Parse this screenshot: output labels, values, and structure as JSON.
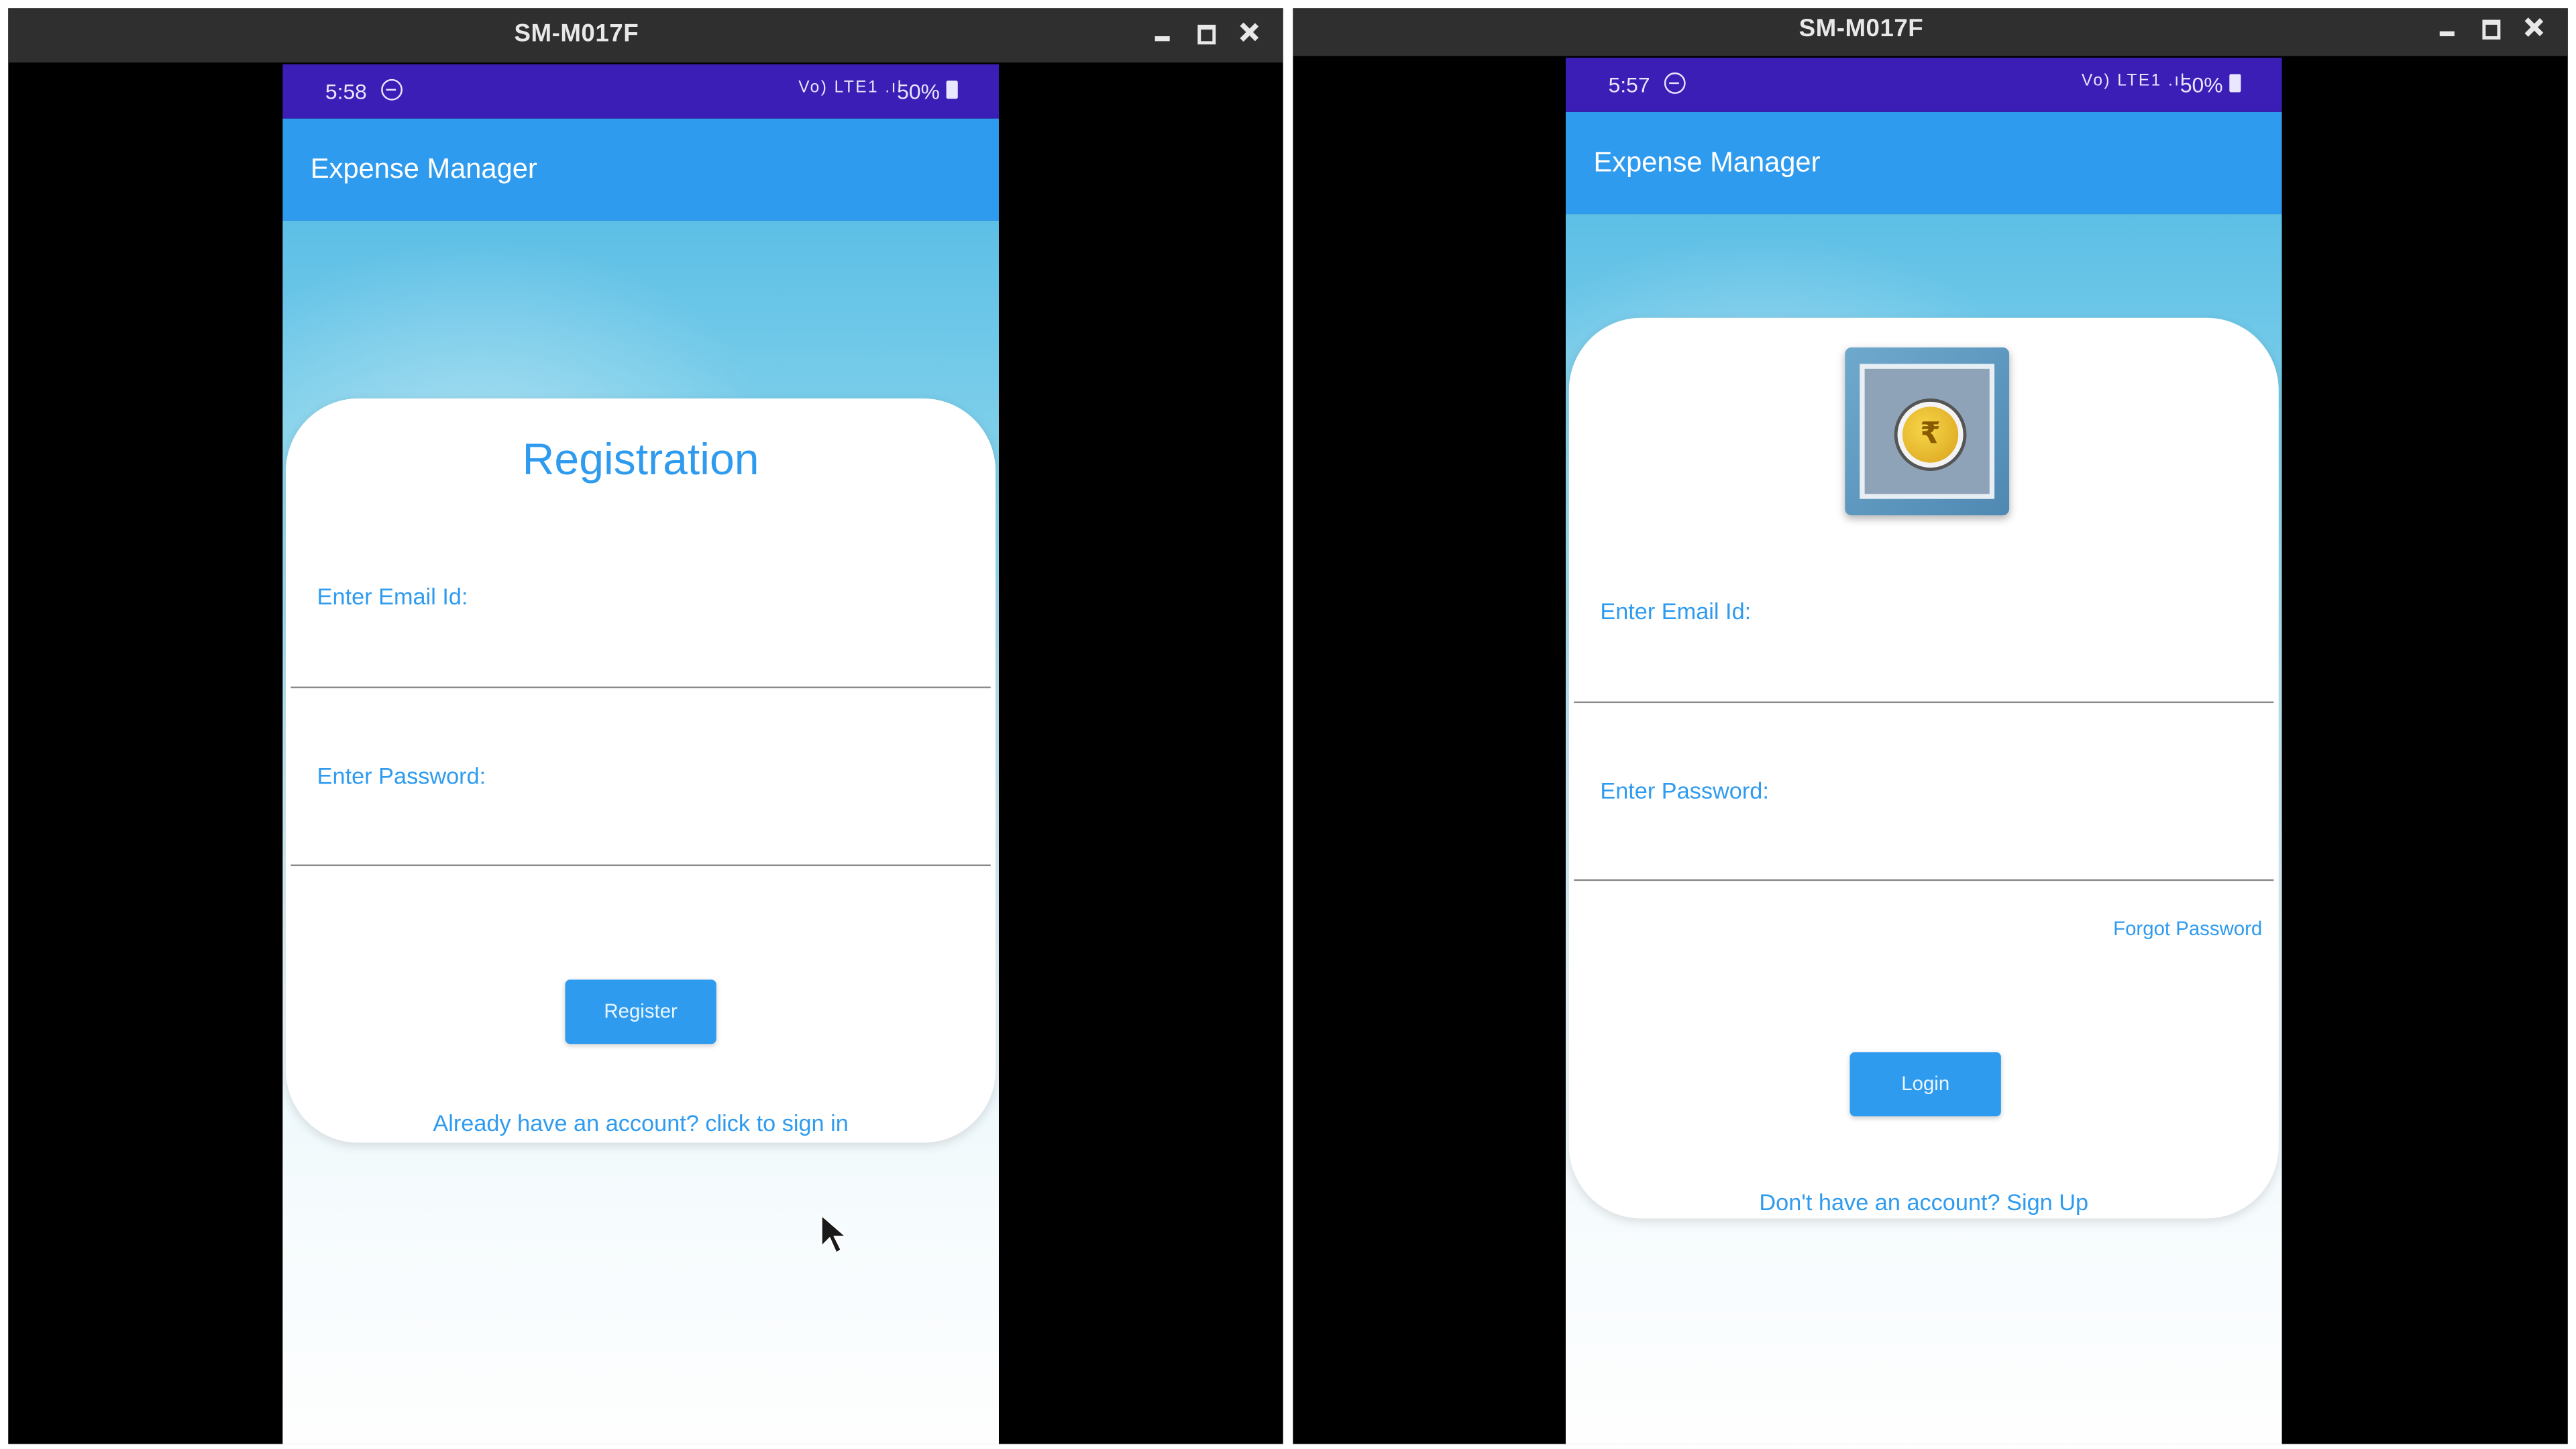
{
  "windows": [
    {
      "title": "SM-M017F",
      "status_bar": {
        "time": "5:58",
        "signal": "Vo) LTE1 .ıl",
        "battery": "50%"
      },
      "app_title": "Expense Manager",
      "screen": {
        "heading": "Registration",
        "email_label": "Enter Email Id:",
        "password_label": "Enter Password:",
        "button_label": "Register",
        "link_text": "Already have an account? click to sign in"
      }
    },
    {
      "title": "SM-M017F",
      "status_bar": {
        "time": "5:57",
        "signal": "Vo) LTE1 .ıl",
        "battery": "50%"
      },
      "app_title": "Expense Manager",
      "screen": {
        "logo_symbol": "₹",
        "email_label": "Enter Email Id:",
        "password_label": "Enter Password:",
        "forgot_label": "Forgot Password",
        "button_label": "Login",
        "link_text": "Don't have an account? Sign Up"
      }
    }
  ],
  "colors": {
    "status_bar": "#3b1eb5",
    "app_bar": "#2f9bef",
    "accent_text": "#2f9bef",
    "window_titlebar": "#2f2f2f"
  },
  "icons": [
    "minimize-icon",
    "maximize-icon",
    "close-icon",
    "dnd-icon",
    "battery-icon",
    "rupee-coin-icon",
    "mouse-pointer-icon"
  ]
}
